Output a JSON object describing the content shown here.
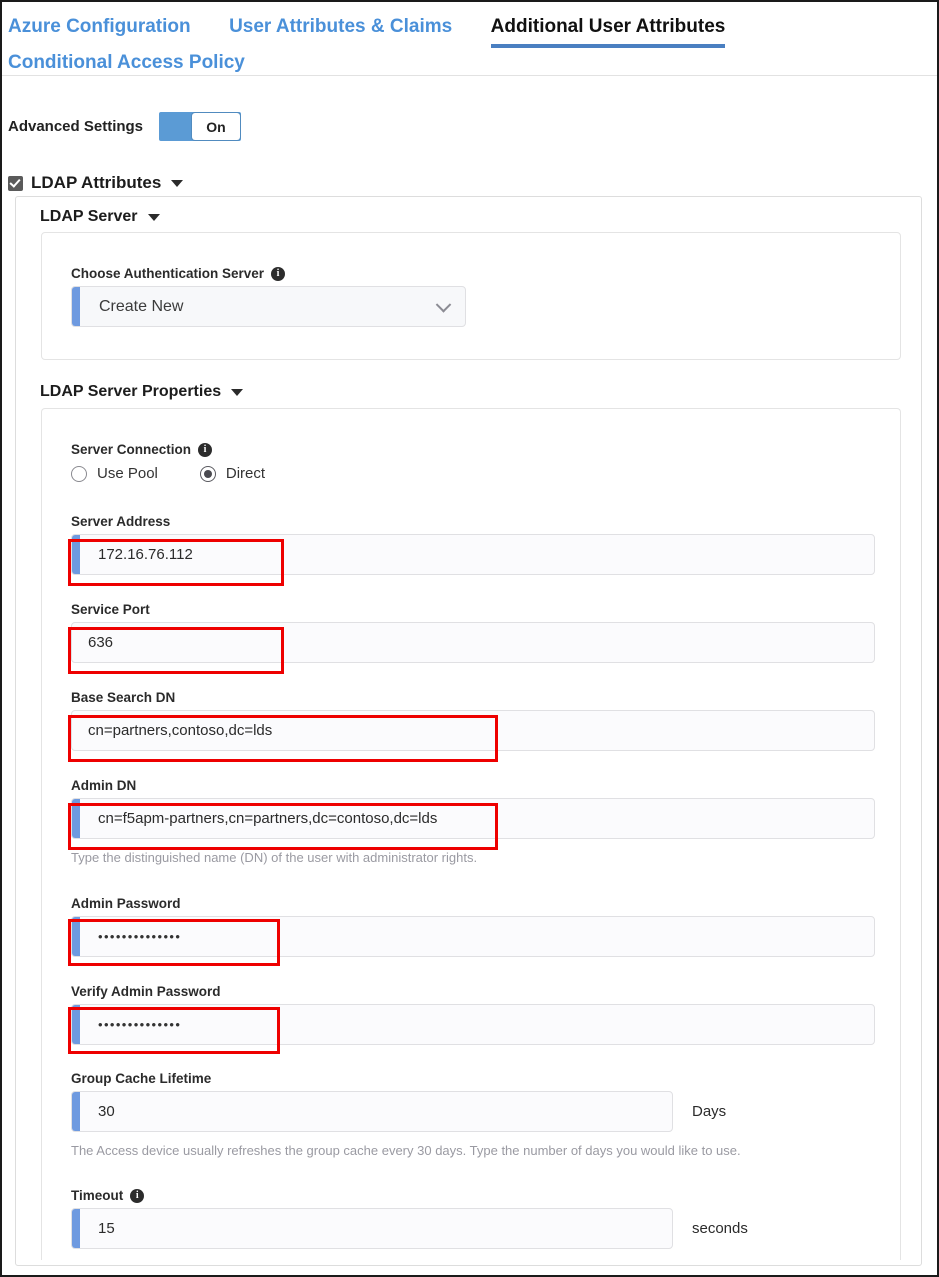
{
  "tabs": [
    {
      "label": "Azure Configuration",
      "active": false
    },
    {
      "label": "User Attributes & Claims",
      "active": false
    },
    {
      "label": "Additional User Attributes",
      "active": true
    },
    {
      "label": "Conditional Access Policy",
      "active": false
    }
  ],
  "advanced_settings": {
    "label": "Advanced Settings",
    "toggle_value": "On"
  },
  "ldap_attributes": {
    "title": "LDAP Attributes",
    "checked": true
  },
  "ldap_server": {
    "title": "LDAP Server",
    "choose_auth_server": {
      "label": "Choose Authentication Server",
      "value": "Create New",
      "info": "i"
    }
  },
  "ldap_server_properties": {
    "title": "LDAP Server Properties",
    "server_connection": {
      "label": "Server Connection",
      "info": "i",
      "options": [
        {
          "label": "Use Pool",
          "selected": false
        },
        {
          "label": "Direct",
          "selected": true
        }
      ]
    },
    "server_address": {
      "label": "Server Address",
      "value": "172.16.76.112",
      "highlighted": true
    },
    "service_port": {
      "label": "Service Port",
      "value": "636",
      "highlighted": true
    },
    "base_search_dn": {
      "label": "Base Search DN",
      "value": "cn=partners,contoso,dc=lds",
      "highlighted": true
    },
    "admin_dn": {
      "label": "Admin DN",
      "value": "cn=f5apm-partners,cn=partners,dc=contoso,dc=lds",
      "helper": "Type the distinguished name (DN) of the user with administrator rights.",
      "highlighted": true
    },
    "admin_password": {
      "label": "Admin Password",
      "value": "••••••••••••••",
      "highlighted": true
    },
    "verify_admin_password": {
      "label": "Verify Admin Password",
      "value": "••••••••••••••",
      "highlighted": true
    },
    "group_cache_lifetime": {
      "label": "Group Cache Lifetime",
      "value": "30",
      "unit": "Days",
      "helper": "The Access device usually refreshes the group cache every 30 days. Type the number of days you would like to use."
    },
    "timeout": {
      "label": "Timeout",
      "info": "i",
      "value": "15",
      "unit": "seconds"
    }
  },
  "colors": {
    "tab_link": "#4a90d9",
    "tab_active_underline": "#4a7fc1",
    "toggle_on": "#5b9bd5",
    "field_accent": "#6e9ae0",
    "highlight": "#ee0000"
  }
}
